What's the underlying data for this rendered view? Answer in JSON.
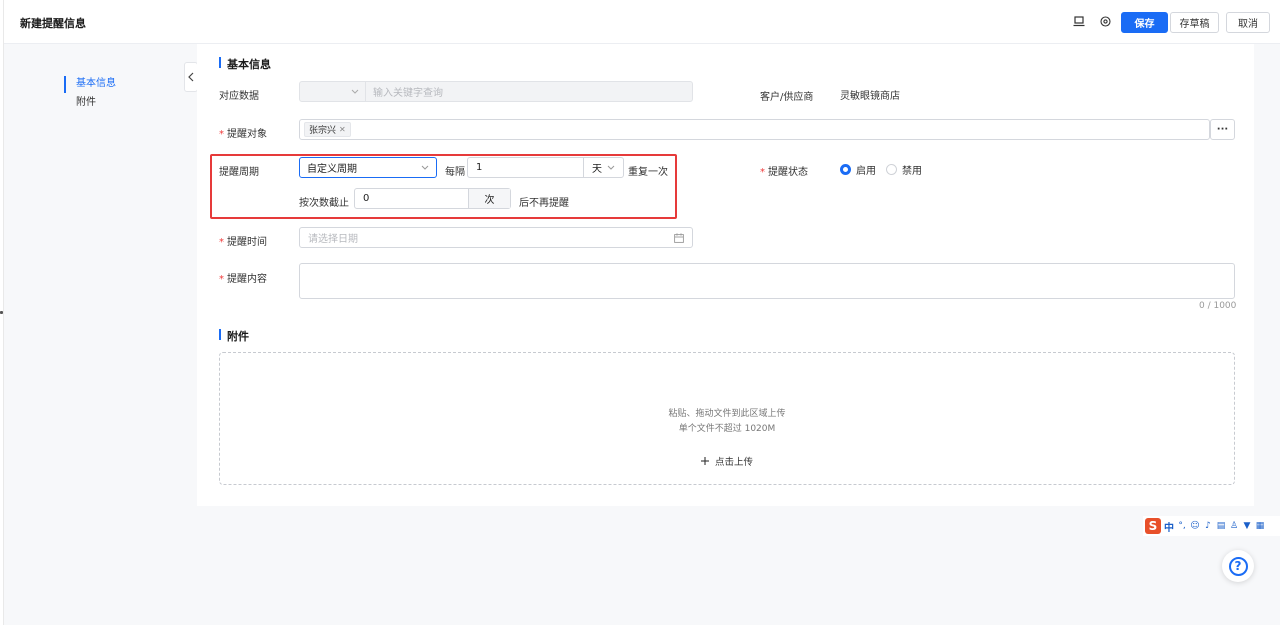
{
  "header": {
    "title": "新建提醒信息",
    "icons": [
      "laptop-icon",
      "settings-circle-icon"
    ],
    "save_label": "保存",
    "draft_label": "存草稿",
    "cancel_label": "取消"
  },
  "anchor_nav": {
    "items": [
      {
        "label": "基本信息",
        "active": true
      },
      {
        "label": "附件",
        "active": false
      }
    ]
  },
  "basic": {
    "section_title": "基本信息",
    "related_data": {
      "label": "对应数据",
      "search_placeholder": "输入关键字查询"
    },
    "customer": {
      "label": "客户/供应商",
      "value": "灵敏眼镜商店"
    },
    "target": {
      "label": "提醒对象",
      "tags": [
        "张宗兴"
      ],
      "more": "···"
    },
    "cycle": {
      "label": "提醒周期",
      "type_value": "自定义周期",
      "every_label": "每隔",
      "every_value": "1",
      "unit_value": "天",
      "repeat_label": "重复一次",
      "stop_label": "按次数截止",
      "stop_value": "0",
      "stop_unit": "次",
      "stop_suffix": "后不再提醒"
    },
    "status": {
      "label": "提醒状态",
      "options": [
        {
          "label": "启用",
          "selected": true
        },
        {
          "label": "禁用",
          "selected": false
        }
      ]
    },
    "time": {
      "label": "提醒时间",
      "placeholder": "请选择日期"
    },
    "content": {
      "label": "提醒内容",
      "counter": "0 / 1000"
    }
  },
  "attachment": {
    "section_title": "附件",
    "hint_line1": "粘贴、拖动文件到此区域上传",
    "hint_line2": "单个文件不超过 1020M",
    "upload_label": "点击上传"
  },
  "ime": {
    "logo": "S",
    "lang": "中",
    "icons": [
      "punctuation-icon",
      "emoji-icon",
      "mic-icon",
      "keyboard-icon",
      "user-icon",
      "skin-icon",
      "grid-icon"
    ]
  },
  "help": {
    "label": "?"
  },
  "colors": {
    "primary": "#1a6cf5",
    "required": "#f03a3a",
    "highlight": "#e63a3a"
  }
}
